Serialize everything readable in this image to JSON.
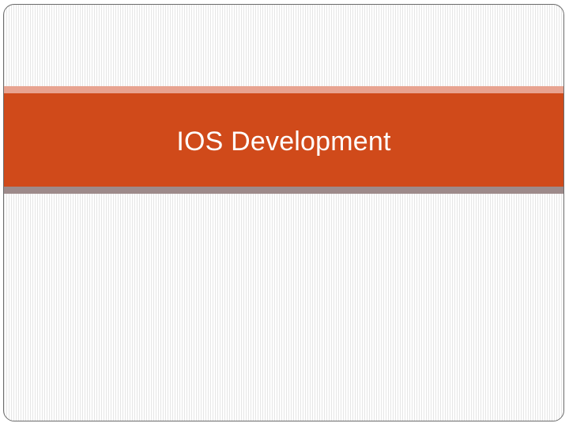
{
  "slide": {
    "title": "IOS Development"
  },
  "colors": {
    "band_main": "#d04a1a",
    "band_top": "#e8a390",
    "band_bottom": "#9d8a8a",
    "title_text": "#ffffff",
    "slide_border": "#6b6b6b",
    "background_stripes": "#e6e6e6"
  }
}
